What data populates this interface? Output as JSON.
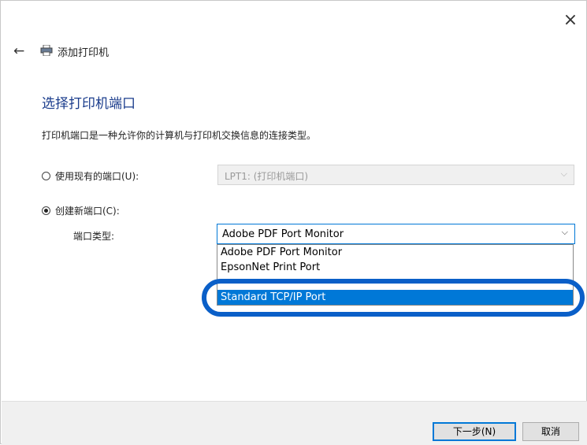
{
  "window": {
    "close_glyph": "×"
  },
  "header": {
    "back_glyph": "←",
    "title": "添加打印机"
  },
  "main": {
    "title": "选择打印机端口",
    "description": "打印机端口是一种允许你的计算机与打印机交换信息的连接类型。",
    "use_existing": {
      "label": "使用现有的端口(U):",
      "checked": false,
      "value": "LPT1: (打印机端口)"
    },
    "create_new": {
      "label": "创建新端口(C):",
      "checked": true
    },
    "port_type": {
      "label": "端口类型:",
      "selected_value": "Adobe PDF Port Monitor",
      "options": [
        "Adobe PDF Port Monitor",
        "EpsonNet Print Port",
        "",
        "Standard TCP/IP Port"
      ],
      "highlighted_option": "Standard TCP/IP Port"
    }
  },
  "footer": {
    "next_label": "下一步(N)",
    "cancel_label": "取消"
  },
  "colors": {
    "accent": "#0078d7",
    "title_blue": "#1a3c8c",
    "highlight_ring": "#0a5fc8"
  },
  "icons": {
    "back": "arrow-left-icon",
    "printer": "printer-icon",
    "close": "close-icon",
    "dropdown": "chevron-down-icon"
  }
}
